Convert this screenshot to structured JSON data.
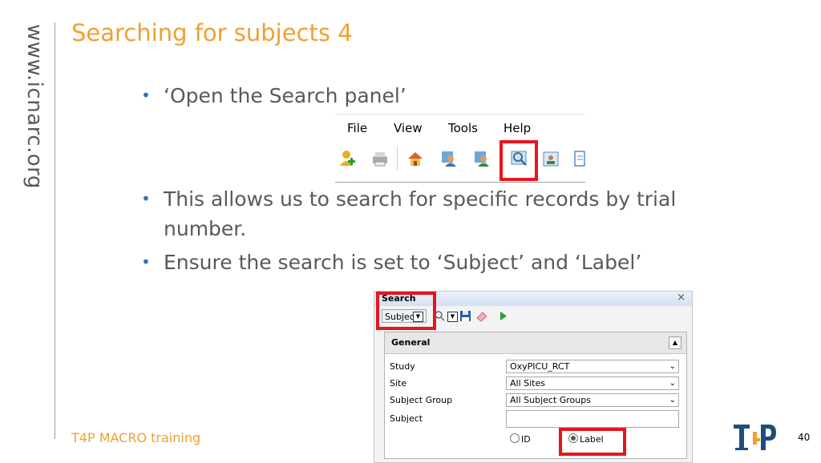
{
  "side_url": "www.icnarc.org",
  "title": "Searching for subjects 4",
  "bullets": [
    "‘Open the Search panel’",
    "This allows us to search for specific records by trial number.",
    "Ensure the search is set to ‘Subject’ and ‘Label’"
  ],
  "menu": {
    "items": [
      "File",
      "View",
      "Tools",
      "Help"
    ],
    "toolbar_icons": [
      "add-subject-icon",
      "print-icon",
      "home-icon",
      "users-icon",
      "users-refresh-icon",
      "search-icon",
      "report-icon",
      "document-icon"
    ]
  },
  "search_panel": {
    "title": "Search",
    "close": "×",
    "type_select": "Subject",
    "general_label": "General",
    "fields": [
      {
        "label": "Study",
        "value": "OxyPICU_RCT"
      },
      {
        "label": "Site",
        "value": "All Sites"
      },
      {
        "label": "Subject Group",
        "value": "All Subject Groups"
      },
      {
        "label": "Subject",
        "value": ""
      }
    ],
    "radio_id": "ID",
    "radio_label": "Label",
    "selected_radio": "Label"
  },
  "highlight_color": "#E8141E",
  "accent_color": "#F0A030",
  "footer": "T4P MACRO training",
  "logo_text": "T4P",
  "page_number": "40"
}
